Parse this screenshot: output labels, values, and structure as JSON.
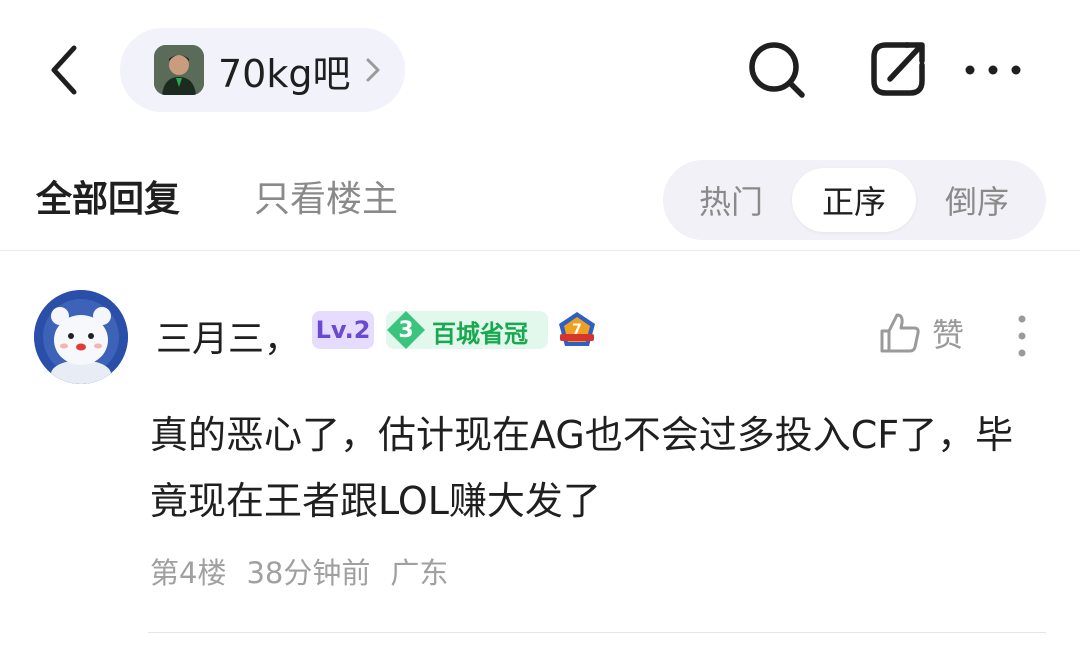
{
  "header": {
    "forum_name": "70kg吧",
    "icons": {
      "back": "back-arrow-icon",
      "search": "search-icon",
      "share": "share-icon",
      "more": "more-horizontal-icon"
    }
  },
  "tabs": {
    "all_replies": "全部回复",
    "only_op": "只看楼主"
  },
  "sort": {
    "options": [
      "热门",
      "正序",
      "倒序"
    ],
    "selected": "正序"
  },
  "comment": {
    "username": "三月三，",
    "level": "Lv.2",
    "title_badge_num": "3",
    "title_badge_text": "百城省冠",
    "medal_num": "7",
    "like_label": "赞",
    "text": "真的恶心了，估计现在AG也不会过多投入CF了，毕竟现在王者跟LOL赚大发了",
    "floor": "第4楼",
    "time": "38分钟前",
    "location": "广东"
  },
  "colors": {
    "accent_pill": "#f2f2fb",
    "level_badge_bg": "#e6dcff",
    "level_badge_fg": "#6a4ad0",
    "title_badge_bg": "#e3f8ec",
    "title_badge_fg": "#18a84f",
    "muted_text": "#a0a0a0"
  }
}
